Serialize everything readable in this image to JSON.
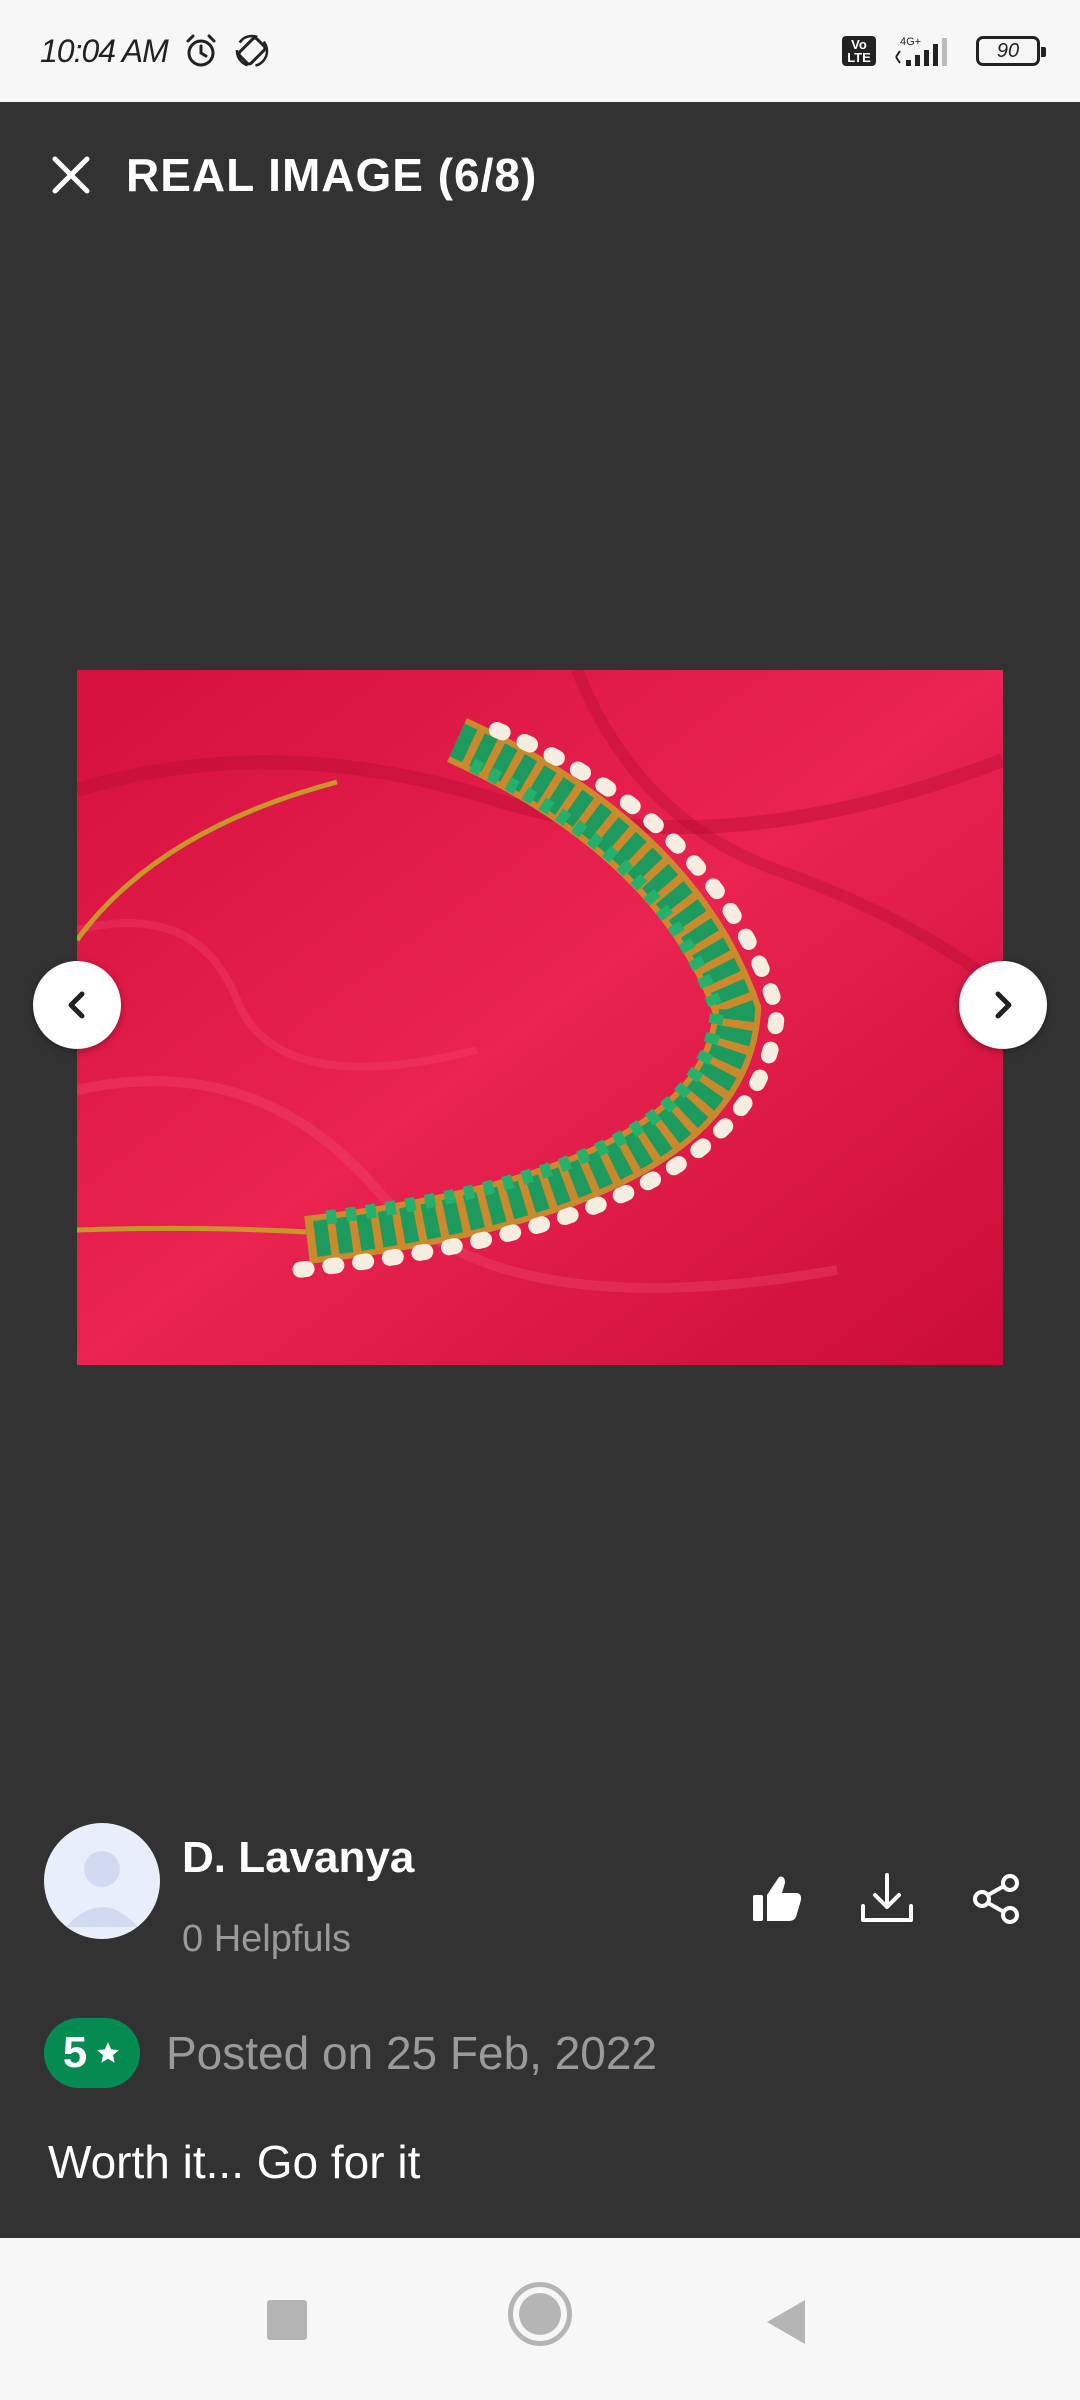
{
  "status_bar": {
    "time": "10:04 AM",
    "volte": "Vo\nLTE",
    "network": "4G+",
    "battery": "90"
  },
  "header": {
    "title": "REAL IMAGE (6/8)"
  },
  "reviewer": {
    "name": "D. Lavanya",
    "helpfuls": "0 Helpfuls"
  },
  "review": {
    "rating": "5",
    "posted": "Posted on 25 Feb, 2022",
    "text": "Worth it... Go for it"
  },
  "icons": {
    "close": "close-icon",
    "prev": "chevron-left-icon",
    "next": "chevron-right-icon",
    "like": "thumbs-up-icon",
    "download": "download-icon",
    "share": "share-icon",
    "star": "star-icon"
  },
  "colors": {
    "background": "#323232",
    "rating_badge": "#058a52",
    "photo_fabric": "#e01a4a",
    "necklace_gold": "#c9962a",
    "necklace_emerald": "#1d9a5e"
  }
}
